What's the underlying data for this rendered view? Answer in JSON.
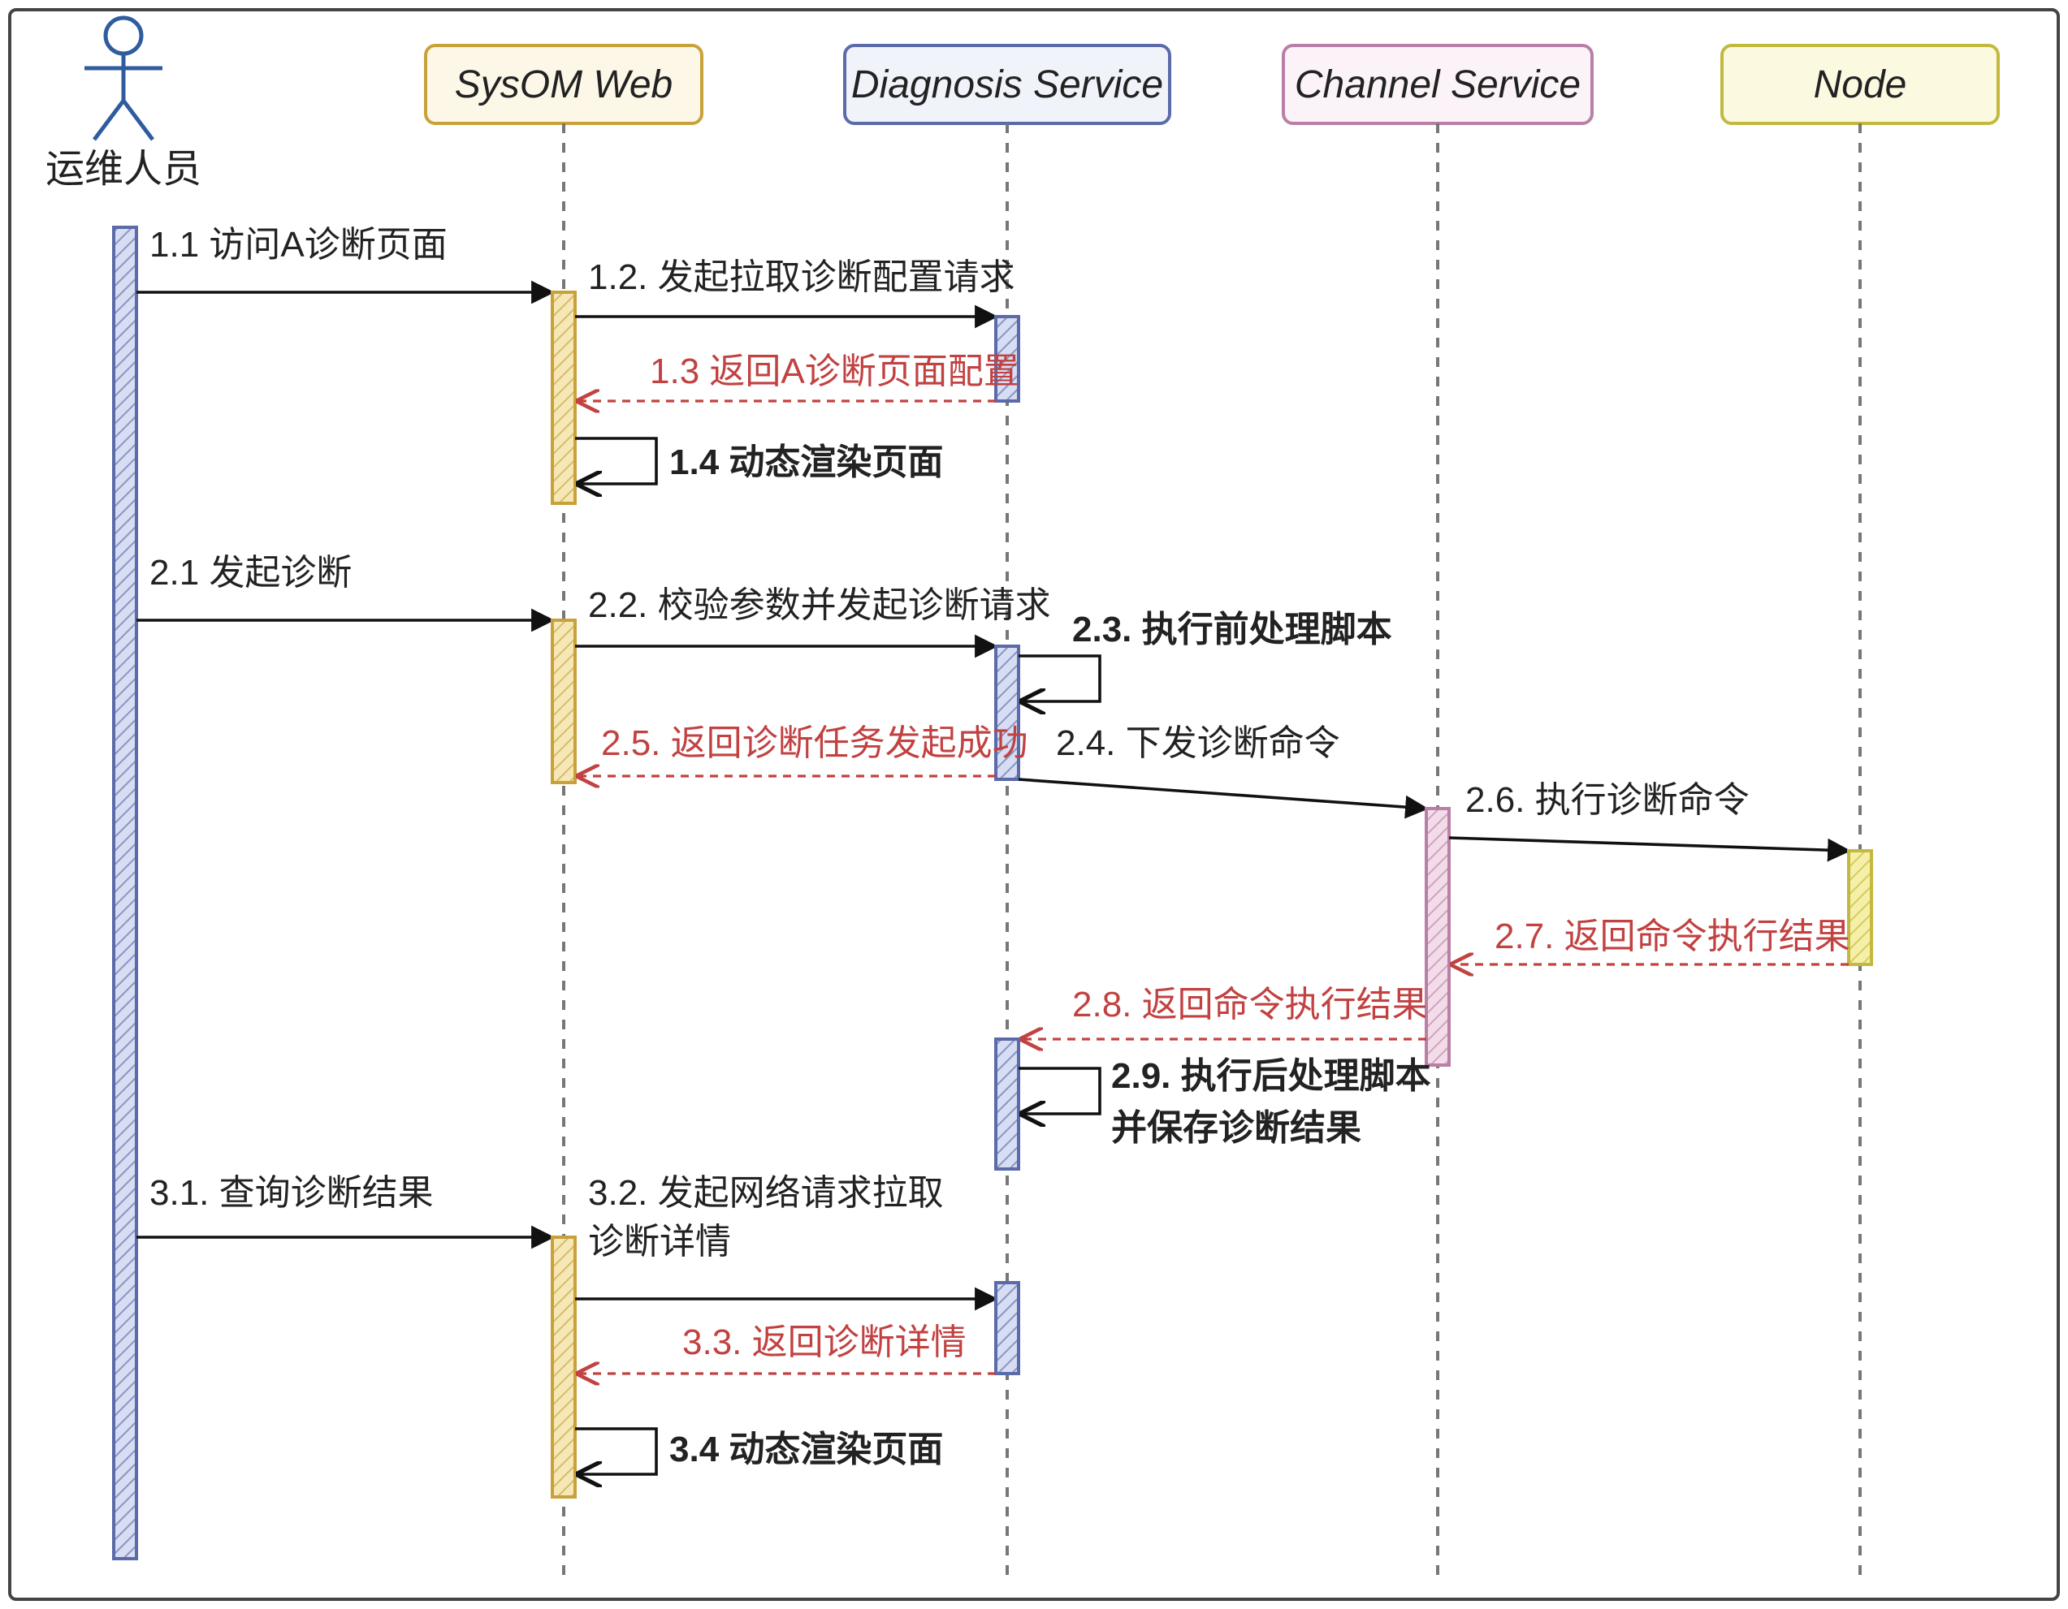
{
  "diagram": {
    "type": "sequence",
    "actor": {
      "label": "运维人员"
    },
    "participants": [
      {
        "id": "web",
        "label": "SysOM Web",
        "color": {
          "fill": "#f6e8b6",
          "stroke": "#c9a13a"
        }
      },
      {
        "id": "diag",
        "label": "Diagnosis Service",
        "color": {
          "fill": "#d7ddf2",
          "stroke": "#5b6aa8"
        }
      },
      {
        "id": "channel",
        "label": "Channel Service",
        "color": {
          "fill": "#f3dce9",
          "stroke": "#b97fa6"
        }
      },
      {
        "id": "node",
        "label": "Node",
        "color": {
          "fill": "#f6efa9",
          "stroke": "#c2b93e"
        }
      }
    ],
    "messages": [
      {
        "id": "m11",
        "from": "actor",
        "to": "web",
        "label": "1.1 访问A诊断页面",
        "kind": "call"
      },
      {
        "id": "m12",
        "from": "web",
        "to": "diag",
        "label": "1.2. 发起拉取诊断配置请求",
        "kind": "call"
      },
      {
        "id": "m13",
        "from": "diag",
        "to": "web",
        "label": "1.3 返回A诊断页面配置",
        "kind": "return"
      },
      {
        "id": "m14",
        "from": "web",
        "to": "web",
        "label": "1.4 动态渲染页面",
        "kind": "self-bold"
      },
      {
        "id": "m21",
        "from": "actor",
        "to": "web",
        "label": "2.1 发起诊断",
        "kind": "call"
      },
      {
        "id": "m22",
        "from": "web",
        "to": "diag",
        "label": "2.2. 校验参数并发起诊断请求",
        "kind": "call"
      },
      {
        "id": "m23",
        "from": "diag",
        "to": "diag",
        "label": "2.3. 执行前处理脚本",
        "kind": "self-bold"
      },
      {
        "id": "m24",
        "from": "diag",
        "to": "channel",
        "label": "2.4. 下发诊断命令",
        "kind": "call"
      },
      {
        "id": "m25",
        "from": "diag",
        "to": "web",
        "label": "2.5. 返回诊断任务发起成功",
        "kind": "return"
      },
      {
        "id": "m26",
        "from": "channel",
        "to": "node",
        "label": "2.6. 执行诊断命令",
        "kind": "call"
      },
      {
        "id": "m27",
        "from": "node",
        "to": "channel",
        "label": "2.7. 返回命令执行结果",
        "kind": "return"
      },
      {
        "id": "m28",
        "from": "channel",
        "to": "diag",
        "label": "2.8. 返回命令执行结果",
        "kind": "return"
      },
      {
        "id": "m29a",
        "from": "diag",
        "to": "diag",
        "label": "2.9. 执行后处理脚本",
        "kind": "self-bold"
      },
      {
        "id": "m29b",
        "from": "diag",
        "to": "diag",
        "label": "并保存诊断结果",
        "kind": "text-bold"
      },
      {
        "id": "m31",
        "from": "actor",
        "to": "web",
        "label": "3.1. 查询诊断结果",
        "kind": "call"
      },
      {
        "id": "m32a",
        "from": "web",
        "to": "diag",
        "label": "3.2. 发起网络请求拉取",
        "kind": "text"
      },
      {
        "id": "m32b",
        "from": "web",
        "to": "diag",
        "label": "诊断详情",
        "kind": "call"
      },
      {
        "id": "m33",
        "from": "diag",
        "to": "web",
        "label": "3.3. 返回诊断详情",
        "kind": "return"
      },
      {
        "id": "m34",
        "from": "web",
        "to": "web",
        "label": "3.4 动态渲染页面",
        "kind": "self-bold"
      }
    ]
  }
}
